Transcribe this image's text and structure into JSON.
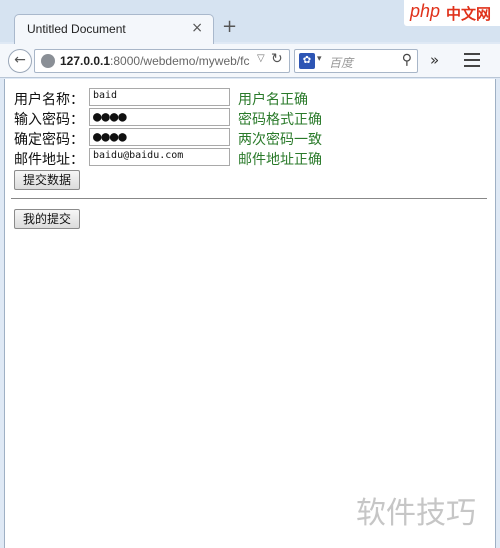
{
  "browser": {
    "tab_title": "Untitled Document",
    "tab_close": "×",
    "new_tab": "+",
    "url_host": "127.0.0.1",
    "url_rest": ":8000/webdemo/myweb/fc",
    "search_placeholder": "百度",
    "php_badge_php": "php",
    "php_badge_cn": "中文网"
  },
  "form": {
    "username": {
      "label": "用户名称：",
      "value": "baid",
      "hint": "用户名正确"
    },
    "password": {
      "label": "输入密码：",
      "value": "●●●●",
      "hint": "密码格式正确"
    },
    "confirm": {
      "label": "确定密码：",
      "value": "●●●●",
      "hint": "两次密码一致"
    },
    "email": {
      "label": "邮件地址：",
      "value": "baidu@baidu.com",
      "hint": "邮件地址正确"
    },
    "submit_label": "提交数据"
  },
  "secondary": {
    "button_label": "我的提交"
  },
  "watermark": "软件技巧",
  "colors": {
    "hint_green": "#2a7a2a",
    "php_red": "#e0321b"
  }
}
